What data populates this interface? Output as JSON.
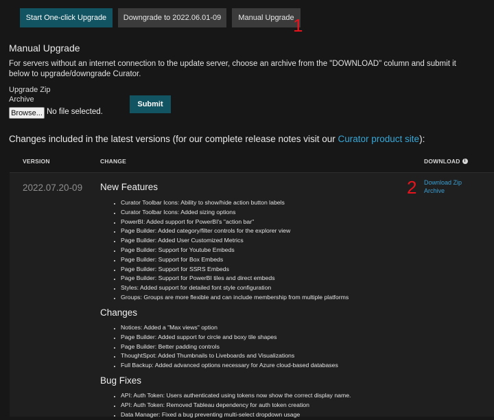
{
  "toolbar": {
    "one_click_label": "Start One-click Upgrade",
    "downgrade_label": "Downgrade to 2022.06.01-09",
    "manual_label": "Manual Upgrade"
  },
  "annotations": {
    "marker_1": "1",
    "marker_2": "2"
  },
  "manual": {
    "title": "Manual Upgrade",
    "description": "For servers without an internet connection to the update server, choose an archive from the \"DOWNLOAD\" column and submit it below to upgrade/downgrade Curator.",
    "zip_label_line1": "Upgrade Zip",
    "zip_label_line2": "Archive",
    "browse_label": "Browse...",
    "no_file_text": "No file selected.",
    "submit_label": "Submit"
  },
  "changes": {
    "heading_prefix": "Changes included in the latest versions (for our complete release notes visit our ",
    "heading_link": "Curator product site",
    "heading_suffix": "):",
    "columns": {
      "version": "VERSION",
      "change": "CHANGE",
      "download": "DOWNLOAD"
    },
    "info_icon": "i"
  },
  "release": {
    "version": "2022.07.20-09",
    "download_zip": "Download Zip",
    "download_archive": "Archive",
    "groups": [
      {
        "title": "New Features",
        "items": [
          "Curator Toolbar Icons: Ability to show/hide action button labels",
          "Curator Toolbar Icons: Added sizing options",
          "PowerBI: Added support for PowerBI's \"action bar\"",
          "Page Builder: Added category/filter controls for the explorer view",
          "Page Builder: Added User Customized Metrics",
          "Page Builder: Support for Youtube Embeds",
          "Page Builder: Support for Box Embeds",
          "Page Builder: Support for SSRS Embeds",
          "Page Builder: Support for PowerBI tiles and direct embeds",
          "Styles: Added support for detailed font style configuration",
          "Groups: Groups are more flexible and can include membership from multiple platforms"
        ]
      },
      {
        "title": "Changes",
        "items": [
          "Notices: Added a \"Max views\" option",
          "Page Builder: Added support for circle and boxy tile shapes",
          "Page Builder: Better padding controls",
          "ThoughtSpot: Added Thumbnails to Liveboards and Visualizations",
          "Full Backup: Added advanced options necessary for Azure cloud-based databases"
        ]
      },
      {
        "title": "Bug Fixes",
        "items": [
          "API: Auth Token: Users authenticated using tokens now show the correct display name.",
          "API: Auth Token: Removed Tableau dependency for auth token creation",
          "Data Manager: Fixed a bug preventing multi-select dropdown usage"
        ]
      }
    ]
  }
}
